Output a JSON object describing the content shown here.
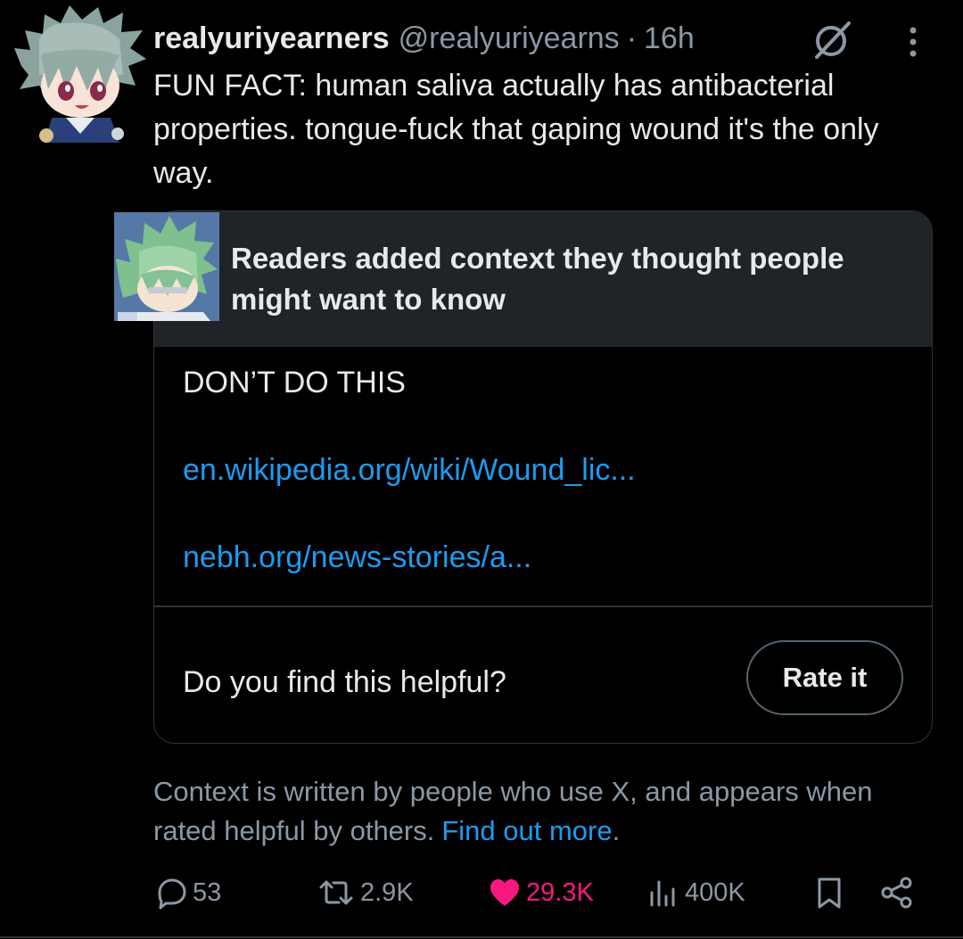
{
  "tweet": {
    "display_name": "realyuriyearners",
    "handle": "@realyuriyearns",
    "separator": "·",
    "time": "16h",
    "text": "FUN FACT: human saliva actually has antibacterial properties. tongue-fuck that gaping wound it's the only way."
  },
  "community_note": {
    "title": "Readers added context they thought people might want to know",
    "text": "DON’T DO THIS",
    "links": [
      "en.wikipedia.org/wiki/Wound_lic...",
      "nebh.org/news-stories/a..."
    ],
    "helpful_question": "Do you find this helpful?",
    "rate_button": "Rate it"
  },
  "context_info": {
    "text": "Context is written by people who use X, and appears when rated helpful by others.",
    "link": "Find out more",
    "link_suffix": "."
  },
  "actions": {
    "replies": "53",
    "reposts": "2.9K",
    "likes": "29.3K",
    "views": "400K"
  },
  "colors": {
    "background": "#000000",
    "text": "#e7e9ea",
    "secondary": "#8b98a5",
    "link": "#1d9bf0",
    "like": "#f91880",
    "note_header": "#202327",
    "border": "#2f3336"
  },
  "icons": {
    "grok": "grok-icon",
    "more": "more-dots-icon",
    "reply": "reply-icon",
    "repost": "repost-icon",
    "like": "heart-filled-icon",
    "views": "views-icon",
    "bookmark": "bookmark-icon",
    "share": "share-icon"
  }
}
